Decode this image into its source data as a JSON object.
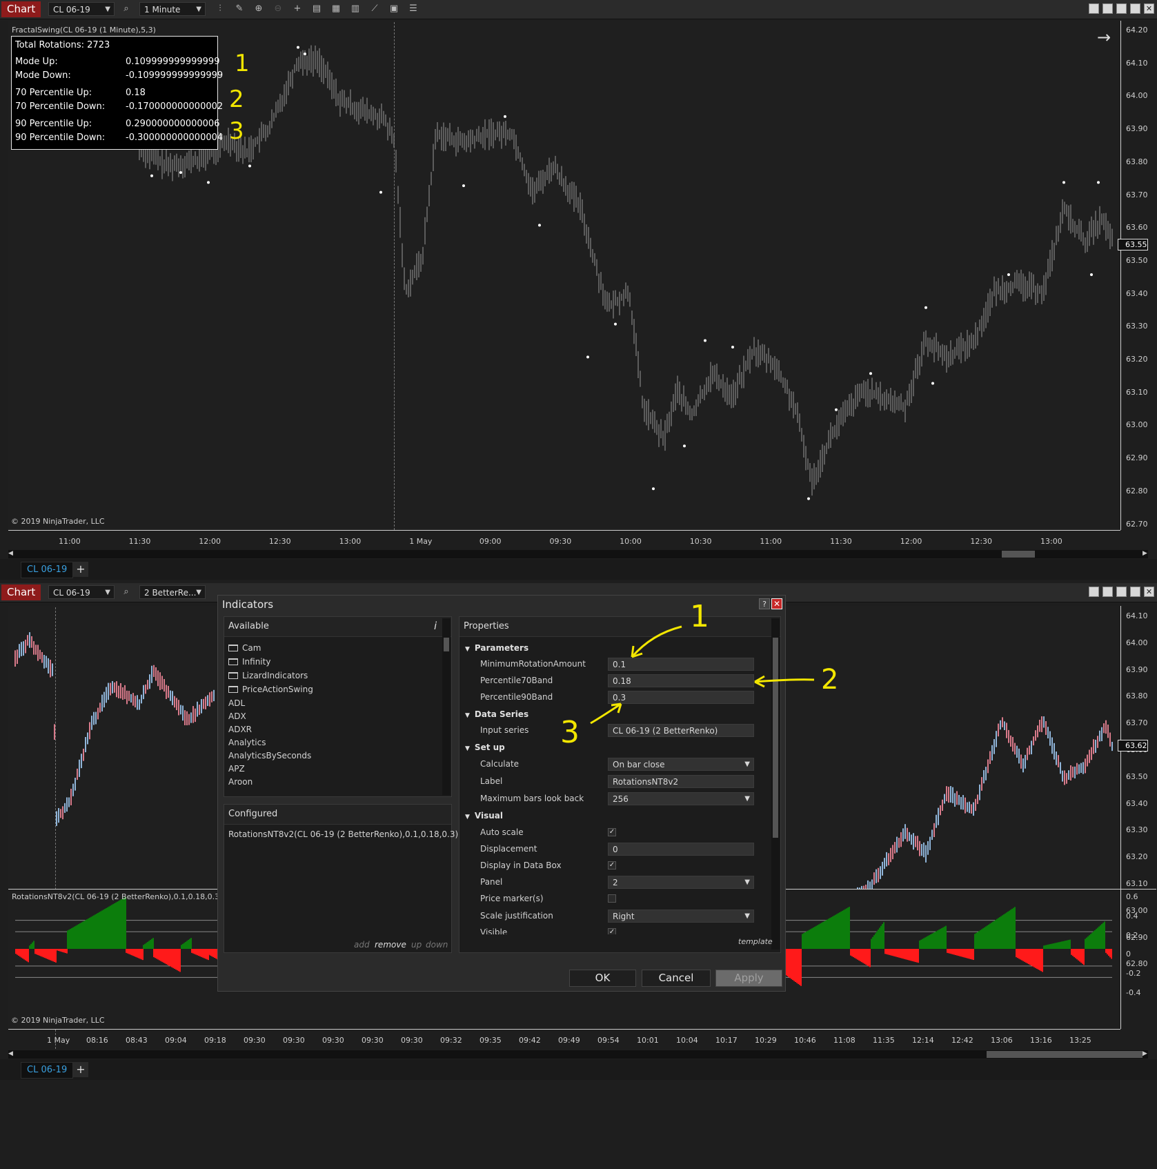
{
  "top_window": {
    "chart_tab": "Chart",
    "instrument": "CL 06-19",
    "interval": "1 Minute",
    "indicator_label": "FractalSwing(CL 06-19 (1 Minute),5,3)",
    "copyright": "© 2019 NinjaTrader, LLC",
    "price_marker": "63.55",
    "price_axis": [
      "64.20",
      "64.10",
      "64.00",
      "63.90",
      "63.80",
      "63.70",
      "63.60",
      "63.50",
      "63.40",
      "63.30",
      "63.20",
      "63.10",
      "63.00",
      "62.90",
      "62.80",
      "62.70"
    ],
    "time_axis": [
      "11:00",
      "11:30",
      "12:00",
      "12:30",
      "13:00",
      "1 May",
      "09:00",
      "09:30",
      "10:00",
      "10:30",
      "11:00",
      "11:30",
      "12:00",
      "12:30",
      "13:00"
    ],
    "tab_label": "CL 06-19",
    "tab_add": "+",
    "stats": {
      "total_rotations": "Total Rotations: 2723",
      "rows": [
        {
          "label": "Mode Up:",
          "value": "0.109999999999999"
        },
        {
          "label": "Mode Down:",
          "value": "-0.109999999999999"
        },
        {
          "label": "70 Percentile Up:",
          "value": "0.18"
        },
        {
          "label": "70 Percentile Down:",
          "value": "-0.170000000000002"
        },
        {
          "label": "90 Percentile Up:",
          "value": "0.290000000000006"
        },
        {
          "label": "90 Percentile Down:",
          "value": "-0.300000000000004"
        }
      ]
    },
    "annotations": [
      "1",
      "2",
      "3"
    ]
  },
  "bottom_window": {
    "chart_tab": "Chart",
    "instrument": "CL 06-19",
    "interval": "2 BetterRe...",
    "price_marker": "63.62",
    "price_axis": [
      "64.10",
      "64.00",
      "63.90",
      "63.80",
      "63.70",
      "63.60",
      "63.50",
      "63.40",
      "63.30",
      "63.20",
      "63.10",
      "63.00",
      "62.90",
      "62.80"
    ],
    "indicator_label": "RotationsNT8v2(CL 06-19 (2 BetterRenko),0.1,0.18,0.3)",
    "indicator_axis": [
      "0.6",
      "0.4",
      "0.2",
      "0",
      "-0.2",
      "-0.4"
    ],
    "copyright": "© 2019 NinjaTrader, LLC",
    "time_axis": [
      "1 May",
      "08:16",
      "08:43",
      "09:04",
      "09:18",
      "09:30",
      "09:30",
      "09:30",
      "09:30",
      "09:30",
      "09:32",
      "09:35",
      "09:42",
      "09:49",
      "09:54",
      "10:01",
      "10:04",
      "10:17",
      "10:29",
      "10:46",
      "11:08",
      "11:35",
      "12:14",
      "12:42",
      "13:06",
      "13:16",
      "13:25"
    ],
    "tab_label": "CL 06-19",
    "tab_add": "+"
  },
  "dialog": {
    "title": "Indicators",
    "help": "?",
    "close": "✕",
    "available_header": "Available",
    "info_icon": "i",
    "available": [
      {
        "label": "Cam",
        "folder": true
      },
      {
        "label": "Infinity",
        "folder": true
      },
      {
        "label": "LizardIndicators",
        "folder": true
      },
      {
        "label": "PriceActionSwing",
        "folder": true
      },
      {
        "label": "ADL",
        "folder": false
      },
      {
        "label": "ADX",
        "folder": false
      },
      {
        "label": "ADXR",
        "folder": false
      },
      {
        "label": "Analytics",
        "folder": false
      },
      {
        "label": "AnalyticsBySeconds",
        "folder": false
      },
      {
        "label": "APZ",
        "folder": false
      },
      {
        "label": "Aroon",
        "folder": false
      }
    ],
    "configured_header": "Configured",
    "configured": [
      "RotationsNT8v2(CL 06-19 (2 BetterRenko),0.1,0.18,0.3)"
    ],
    "list_actions": {
      "add": "add",
      "remove": "remove",
      "up": "up",
      "down": "down"
    },
    "properties_header": "Properties",
    "template": "template",
    "categories": {
      "parameters": "Parameters",
      "data_series": "Data Series",
      "setup": "Set up",
      "visual": "Visual"
    },
    "props": {
      "min_rotation": {
        "label": "MinimumRotationAmount",
        "value": "0.1"
      },
      "p70": {
        "label": "Percentile70Band",
        "value": "0.18"
      },
      "p90": {
        "label": "Percentile90Band",
        "value": "0.3"
      },
      "input_series": {
        "label": "Input series",
        "value": "CL 06-19 (2 BetterRenko)"
      },
      "calculate": {
        "label": "Calculate",
        "value": "On bar close"
      },
      "label": {
        "label": "Label",
        "value": "RotationsNT8v2"
      },
      "max_bars": {
        "label": "Maximum bars look back",
        "value": "256"
      },
      "auto_scale": {
        "label": "Auto scale",
        "checked": "✓"
      },
      "displacement": {
        "label": "Displacement",
        "value": "0"
      },
      "display_data_box": {
        "label": "Display in Data Box",
        "checked": "✓"
      },
      "panel": {
        "label": "Panel",
        "value": "2"
      },
      "price_markers": {
        "label": "Price marker(s)"
      },
      "scale_just": {
        "label": "Scale justification",
        "value": "Right"
      },
      "visible": {
        "label": "Visible",
        "checked": "✓"
      }
    },
    "buttons": {
      "ok": "OK",
      "cancel": "Cancel",
      "apply": "Apply"
    },
    "annotations": [
      "1",
      "2",
      "3"
    ]
  },
  "colors": {
    "chart_tab": "#8e1b1b",
    "bar_up": "#8fb4d8",
    "bar_down": "#d87a8a",
    "hist_up": "#0c7d0c",
    "hist_down": "#ff1a1a",
    "annotation": "#f2e600"
  }
}
